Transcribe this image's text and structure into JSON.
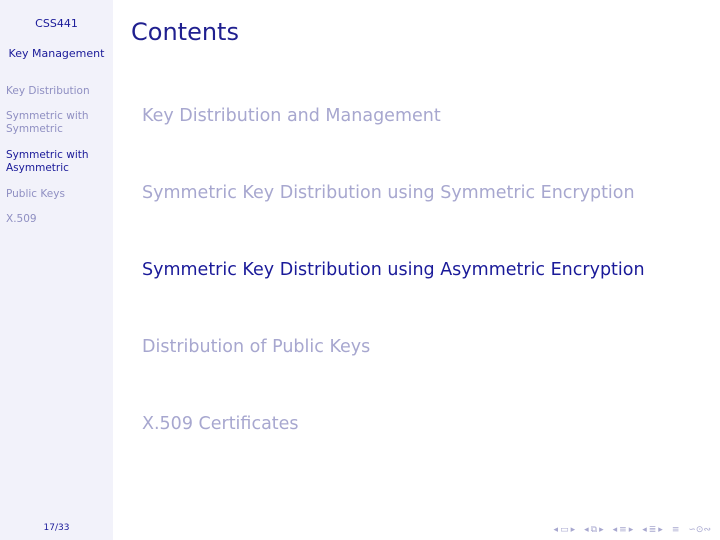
{
  "sidebar": {
    "course": "CSS441",
    "lecture": "Key Management",
    "items": [
      {
        "label_lines": [
          "Key Distribution"
        ],
        "active": false
      },
      {
        "label_lines": [
          "Symmetric with",
          "Symmetric"
        ],
        "active": false
      },
      {
        "label_lines": [
          "Symmetric with",
          "Asymmetric"
        ],
        "active": true
      },
      {
        "label_lines": [
          "Public Keys"
        ],
        "active": false
      },
      {
        "label_lines": [
          "X.509"
        ],
        "active": false
      }
    ],
    "page_counter": "17/33"
  },
  "slide": {
    "title": "Contents",
    "toc": [
      {
        "label": "Key Distribution and Management",
        "active": false
      },
      {
        "label": "Symmetric Key Distribution using Symmetric Encryption",
        "active": false
      },
      {
        "label": "Symmetric Key Distribution using Asymmetric Encryption",
        "active": true
      },
      {
        "label": "Distribution of Public Keys",
        "active": false
      },
      {
        "label": "X.509 Certificates",
        "active": false
      }
    ]
  },
  "nav": {
    "colors": {
      "inactive": "#a7a7cf",
      "active": "#1a1a99"
    },
    "icons": [
      "nav-first-icon",
      "nav-frame-icon",
      "nav-prev-icon",
      "nav-subsection-prev-icon",
      "nav-subsection-icon",
      "nav-subsection-next-icon",
      "nav-section-prev-icon",
      "nav-section-icon",
      "nav-section-next-icon",
      "nav-doc-prev-icon",
      "nav-doc-icon",
      "nav-doc-next-icon",
      "nav-align-icon",
      "nav-search-icon"
    ]
  }
}
